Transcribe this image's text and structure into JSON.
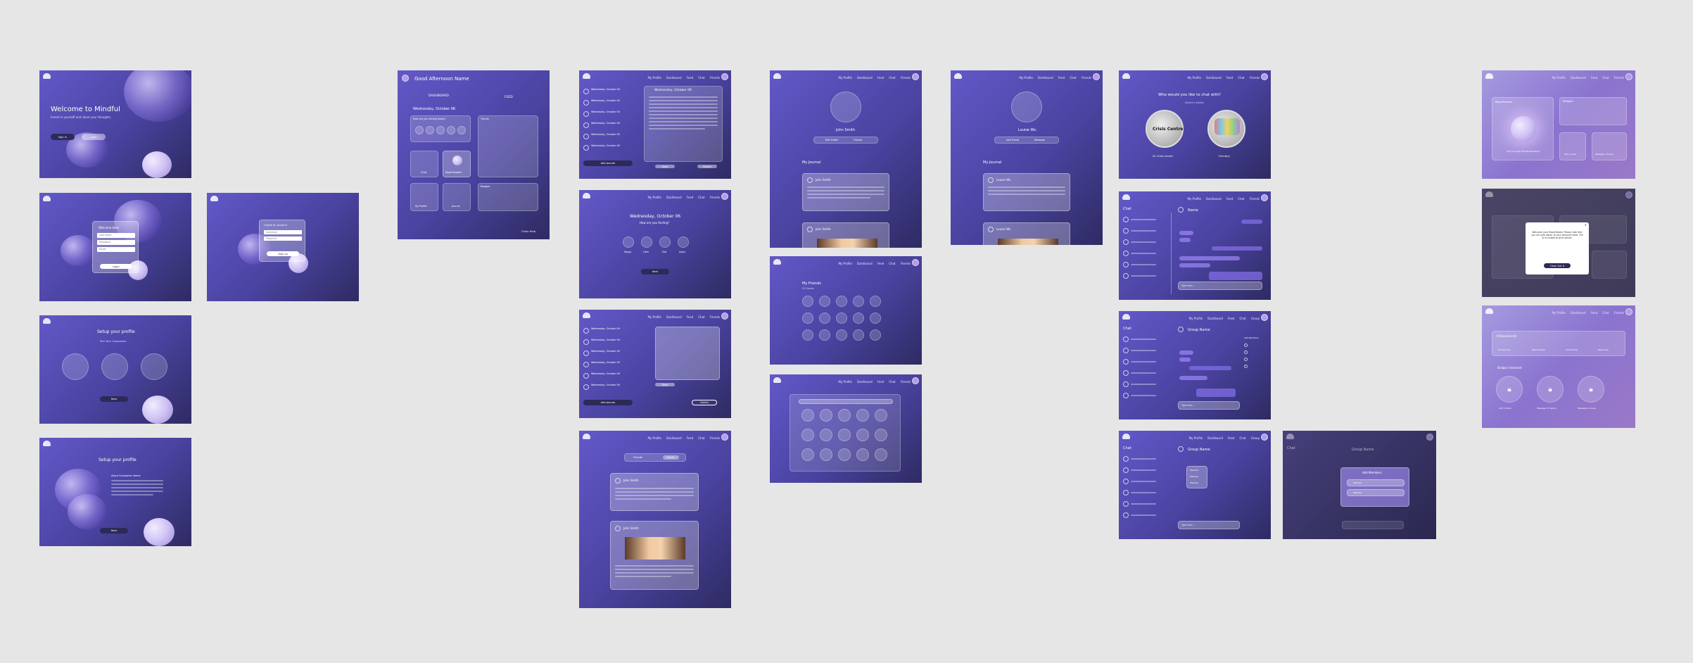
{
  "nav": [
    "My Profile",
    "Dashboard",
    "Feed",
    "Chat",
    "Friends"
  ],
  "nav_group": [
    "My Profile",
    "Dashboard",
    "Feed",
    "Chat",
    "Group"
  ],
  "welcome": {
    "title": "Welcome to Mindful",
    "sub": "Invest in yourself and share your thoughts.",
    "signin": "Sign in",
    "login": "Login"
  },
  "login": {
    "title": "Welcome back",
    "field1": "Username",
    "field2": "Password",
    "button": "Login"
  },
  "signup": {
    "title": "Create an account",
    "field1": "Username",
    "field2": "Email",
    "field3": "Password",
    "button": "Sign up"
  },
  "setup1": {
    "title": "Setup your profile",
    "sub": "Pick Your Companion",
    "button": "Next"
  },
  "setup2": {
    "title": "Setup your profile",
    "sub": "About Companion Name",
    "button": "Next"
  },
  "dash": {
    "greeting": "Good Afternoon Name",
    "tab1": "DASHBOARD",
    "tab2": "FEED",
    "date": "Wednesday, October 06",
    "mood_q": "How are you feeling today?",
    "trends": "Trends",
    "badges": "Badges",
    "chat": "Chat",
    "mood": "Mood Booster",
    "profile": "My Profile",
    "journal": "Journal",
    "footer": "Crisis Help"
  },
  "journal_list": {
    "entries": [
      "Wednesday, October 06",
      "Wednesday, October 06",
      "Wednesday, October 06",
      "Wednesday, October 06",
      "Wednesday, October 06",
      "Wednesday, October 06"
    ],
    "entry_title": "Wednesday, October 06",
    "add": "Add Journal",
    "save": "Save",
    "delete": "Delete"
  },
  "mood_screen": {
    "date": "Wednesday, October 06",
    "question": "How are you feeling?",
    "moods": [
      "Happy",
      "Calm",
      "Sad",
      "Angry"
    ],
    "button": "Next"
  },
  "feed": {
    "tab1": "Friends",
    "tab2": "Public",
    "user": "John Smith"
  },
  "profile": {
    "name": "John Smith",
    "btn1": "Edit Profile",
    "btn2": "Friends",
    "journal": "My Journal",
    "post_user": "John Smith"
  },
  "profile2": {
    "name": "Louise Wu",
    "btn1": "Add Friend",
    "btn2": "Message",
    "journal": "My Journal",
    "post_user": "Louise Wu"
  },
  "friends": {
    "title": "My Friends",
    "count": "32 Friends"
  },
  "chat_with": {
    "question": "Who would you like to chat with?",
    "sub": "Select a buddy",
    "opt1": "AI: Crisis Centre",
    "opt2": "Friend(s)",
    "opt1_logo": "Crisis Centre"
  },
  "chat": {
    "title": "Chat",
    "name": "Name",
    "group": "Group Name",
    "input": "Type here...",
    "add": "Add Members",
    "members": [
      "Member",
      "Member",
      "Member"
    ]
  },
  "mood_booster": {
    "title": "Mood Booster",
    "sub": "Click to begin Mindful Breathing",
    "widgets": "Widgets",
    "take_quiz": "Take a Quiz",
    "message": "Message a Friend",
    "dialog": "Welcome your Mood Buddy. Please note that you are sole owner of your personal data. The AI is unable to give advice.",
    "ok": "Okay Got it"
  },
  "badges": {
    "title": "Achievements",
    "items": [
      "First Journal",
      "Mood Streak",
      "Chat Buddy",
      "Night Owl"
    ],
    "locked_title": "Badges Unlocked",
    "locked": [
      "Add 5 Posts",
      "Message 5 Friends",
      "Message a Group"
    ]
  },
  "colors": {
    "accent": "#6258c8",
    "dark": "#2e2a58"
  }
}
